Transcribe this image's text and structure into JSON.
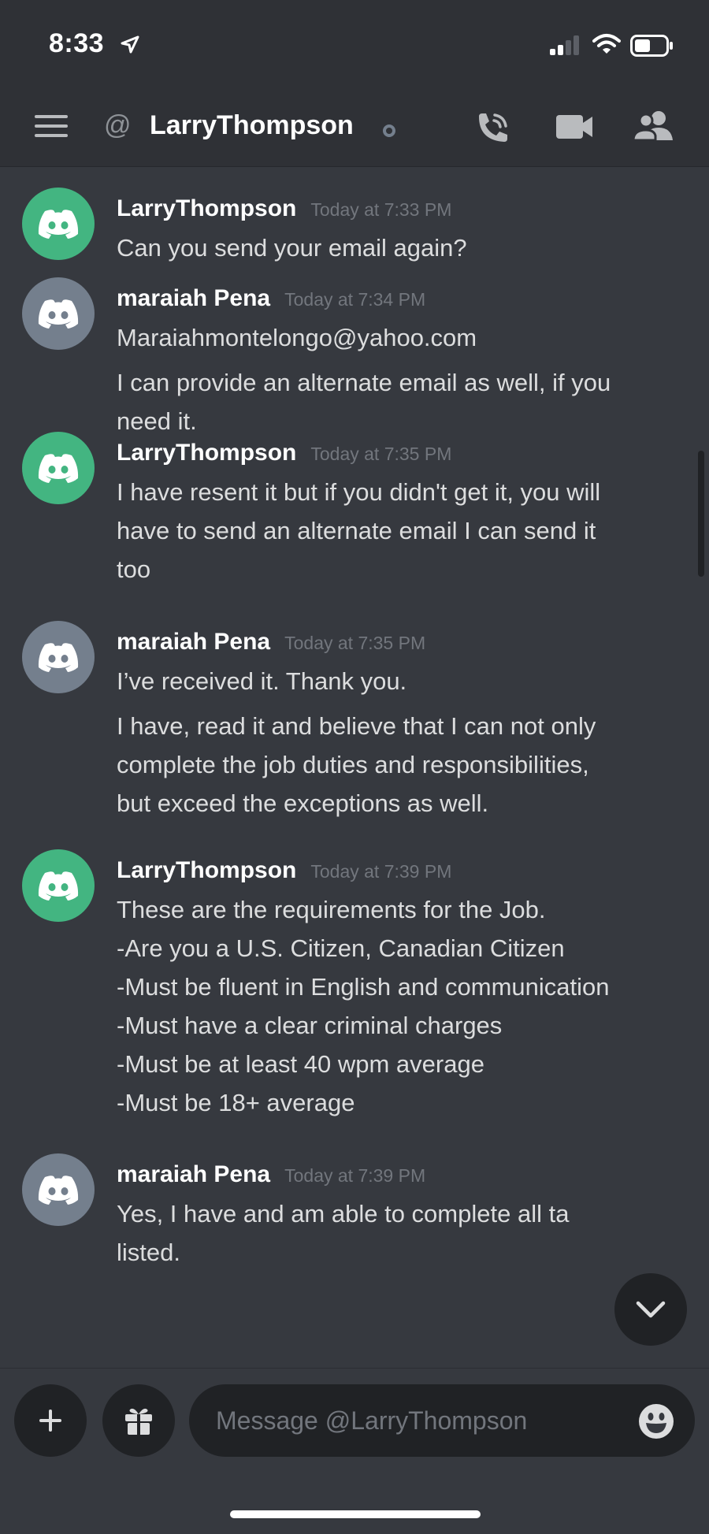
{
  "status_bar": {
    "time": "8:33",
    "icons": [
      "location-arrow-icon",
      "signal-icon",
      "wifi-icon",
      "battery-icon"
    ]
  },
  "header": {
    "at_symbol": "@",
    "channel_name": "LarryThompson",
    "icons": [
      "menu-icon",
      "at-icon",
      "phone-call-icon",
      "video-icon",
      "members-icon"
    ]
  },
  "messages": [
    {
      "author": "LarryThompson",
      "timestamp": "Today at 7:33 PM",
      "avatar_color": "#43b581",
      "lines": [
        "Can you send your email again?"
      ]
    },
    {
      "author": "maraiah Pena",
      "timestamp": "Today at 7:34 PM",
      "avatar_color": "#747f8d",
      "lines": [
        "Maraiahmontelongo@yahoo.com"
      ],
      "lines2": [
        "I can provide an alternate email as well, if you",
        "need it."
      ]
    },
    {
      "author": "LarryThompson",
      "timestamp": "Today at 7:35 PM",
      "avatar_color": "#43b581",
      "lines": [
        "I have resent it but if you didn't get it, you will",
        "have to send an alternate email I can send it",
        "too"
      ]
    },
    {
      "author": "maraiah Pena",
      "timestamp": "Today at 7:35 PM",
      "avatar_color": "#747f8d",
      "lines": [
        "I’ve received it. Thank you."
      ],
      "lines2": [
        "I have, read it and believe that I can not only",
        "complete the job duties and responsibilities,",
        "but exceed the exceptions as well."
      ]
    },
    {
      "author": "LarryThompson",
      "timestamp": "Today at 7:39 PM",
      "avatar_color": "#43b581",
      "lines": [
        "These are the requirements for the Job.",
        "-Are you a U.S. Citizen, Canadian Citizen",
        "-Must be fluent in English and communication",
        "-Must have a clear criminal charges",
        "-Must be at least 40 wpm average",
        "-Must be 18+ average"
      ]
    },
    {
      "author": "maraiah Pena",
      "timestamp": "Today at 7:39 PM",
      "avatar_color": "#747f8d",
      "lines": [
        "Yes,  I have and am able to complete all ta",
        "listed."
      ]
    }
  ],
  "composer": {
    "placeholder": "Message @LarryThompson",
    "icons": [
      "plus-icon",
      "gift-icon",
      "emoji-icon",
      "chevron-down-icon"
    ]
  },
  "colors": {
    "background": "#36393f",
    "header_background": "#2f3136",
    "online_green": "#43b581",
    "gray_avatar": "#747f8d",
    "input_background": "#202225"
  }
}
